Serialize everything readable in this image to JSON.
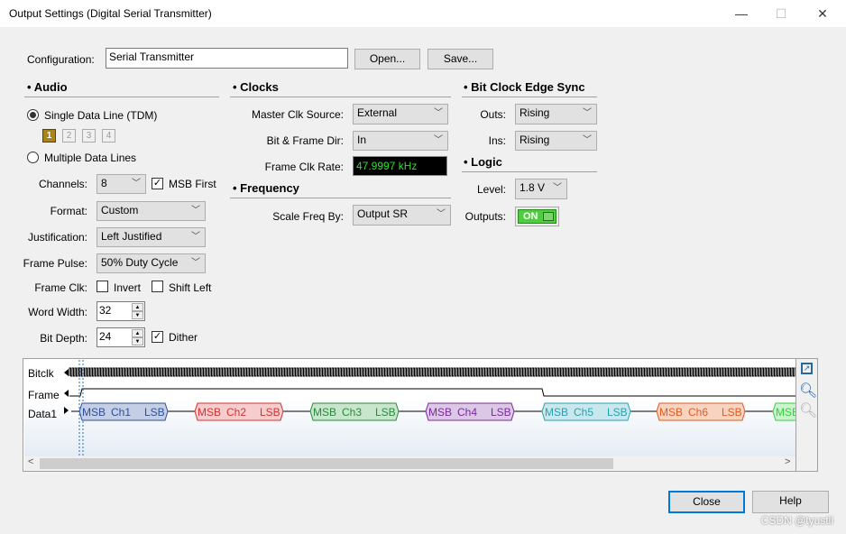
{
  "window": {
    "title": "Output Settings (Digital Serial Transmitter)",
    "minimize": "—",
    "maximize": "☐",
    "close": "✕"
  },
  "config": {
    "label": "Configuration:",
    "value": "Serial Transmitter",
    "open": "Open...",
    "save": "Save..."
  },
  "audio": {
    "header": "Audio",
    "single": "Single Data Line (TDM)",
    "single_selected": true,
    "lines": [
      "1",
      "2",
      "3",
      "4"
    ],
    "active_line": "1",
    "multiple": "Multiple Data Lines",
    "channels_label": "Channels:",
    "channels": "8",
    "msb_first": "MSB First",
    "msb_first_checked": true,
    "format_label": "Format:",
    "format": "Custom",
    "justification_label": "Justification:",
    "justification": "Left Justified",
    "frame_pulse_label": "Frame Pulse:",
    "frame_pulse": "50% Duty Cycle",
    "frame_clk_label": "Frame Clk:",
    "invert": "Invert",
    "invert_checked": false,
    "shift_left": "Shift Left",
    "shift_left_checked": false,
    "word_width_label": "Word Width:",
    "word_width": "32",
    "bit_depth_label": "Bit Depth:",
    "bit_depth": "24",
    "dither": "Dither",
    "dither_checked": true
  },
  "clocks": {
    "header": "Clocks",
    "master_label": "Master Clk Source:",
    "master": "External",
    "dir_label": "Bit & Frame Dir:",
    "dir": "In",
    "rate_label": "Frame Clk Rate:",
    "rate": "47.9997 kHz"
  },
  "frequency": {
    "header": "Frequency",
    "scale_label": "Scale Freq By:",
    "scale": "Output SR"
  },
  "edge": {
    "header": "Bit Clock Edge Sync",
    "outs_label": "Outs:",
    "outs": "Rising",
    "ins_label": "Ins:",
    "ins": "Rising"
  },
  "logic": {
    "header": "Logic",
    "level_label": "Level:",
    "level": "1.8 V",
    "outputs_label": "Outputs:",
    "outputs": "ON",
    "outputs_on": true
  },
  "waveform": {
    "signals": [
      "Bitclk",
      "Frame",
      "Data1"
    ],
    "channels": [
      {
        "msb": "MSB",
        "name": "Ch1",
        "lsb": "LSB",
        "color": "#2e4f96",
        "fill": "#c4cfe6"
      },
      {
        "msb": "MSB",
        "name": "Ch2",
        "lsb": "LSB",
        "color": "#d03434",
        "fill": "#f6cccc"
      },
      {
        "msb": "MSB",
        "name": "Ch3",
        "lsb": "LSB",
        "color": "#2a8a3a",
        "fill": "#c8e6cc"
      },
      {
        "msb": "MSB",
        "name": "Ch4",
        "lsb": "LSB",
        "color": "#7a2a9a",
        "fill": "#dcc8e6"
      },
      {
        "msb": "MSB",
        "name": "Ch5",
        "lsb": "LSB",
        "color": "#2aa0b0",
        "fill": "#c8e8ee"
      },
      {
        "msb": "MSB",
        "name": "Ch6",
        "lsb": "LSB",
        "color": "#e05a20",
        "fill": "#f8d4c0"
      },
      {
        "msb": "MSB",
        "name": "",
        "lsb": "",
        "color": "#30d040",
        "fill": "#ccf4cc"
      }
    ]
  },
  "buttons": {
    "close": "Close",
    "help": "Help"
  },
  "watermark": "CSDN @tyustli"
}
